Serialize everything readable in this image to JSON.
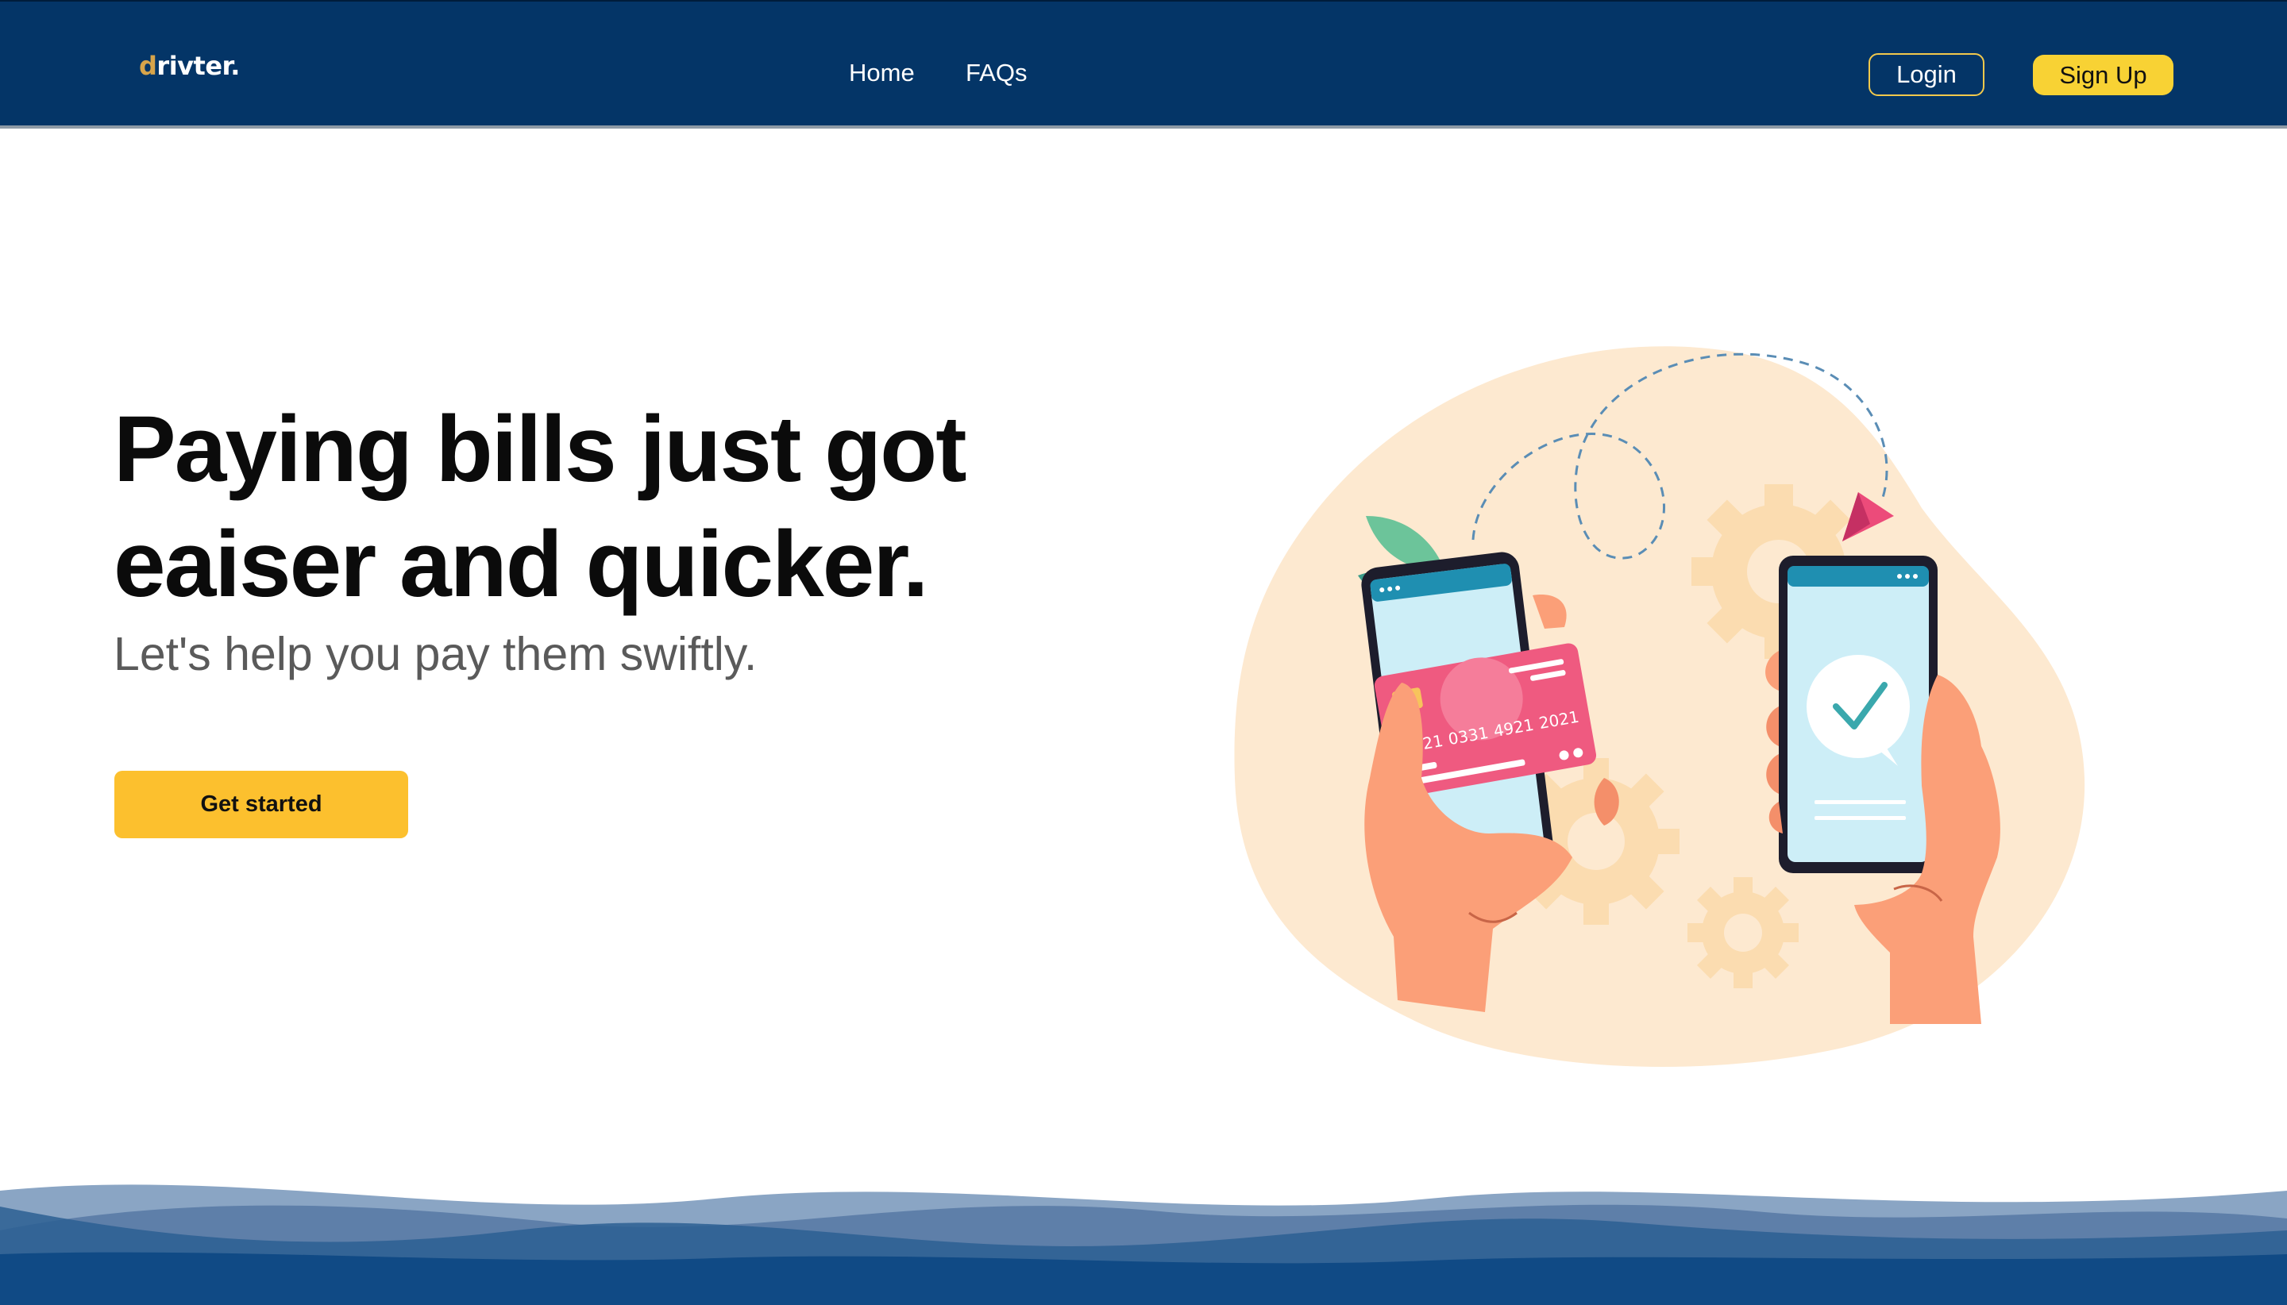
{
  "brand": {
    "logo_first": "d",
    "logo_rest": "rivter."
  },
  "nav": {
    "links": [
      {
        "label": "Home"
      },
      {
        "label": "FAQs"
      }
    ],
    "login_label": "Login",
    "signup_label": "Sign Up"
  },
  "hero": {
    "title_line1": "Paying bills just got",
    "title_line2": "eaiser and quicker.",
    "subtitle": "Let's help you pay them swiftly.",
    "cta_label": "Get started"
  },
  "card": {
    "number": [
      "0021",
      "0331",
      "4921",
      "2021"
    ]
  },
  "colors": {
    "nav_bg": "#043567",
    "accent_yellow": "#fcc02e",
    "logo_accent": "#d7a44a",
    "blob": "#fde9d0",
    "card_pink": "#ee5b7f",
    "wave_dark": "#104a85"
  },
  "icons": {
    "check": "checkmark-icon",
    "plane": "paper-plane-icon",
    "gear": "gear-icon"
  }
}
